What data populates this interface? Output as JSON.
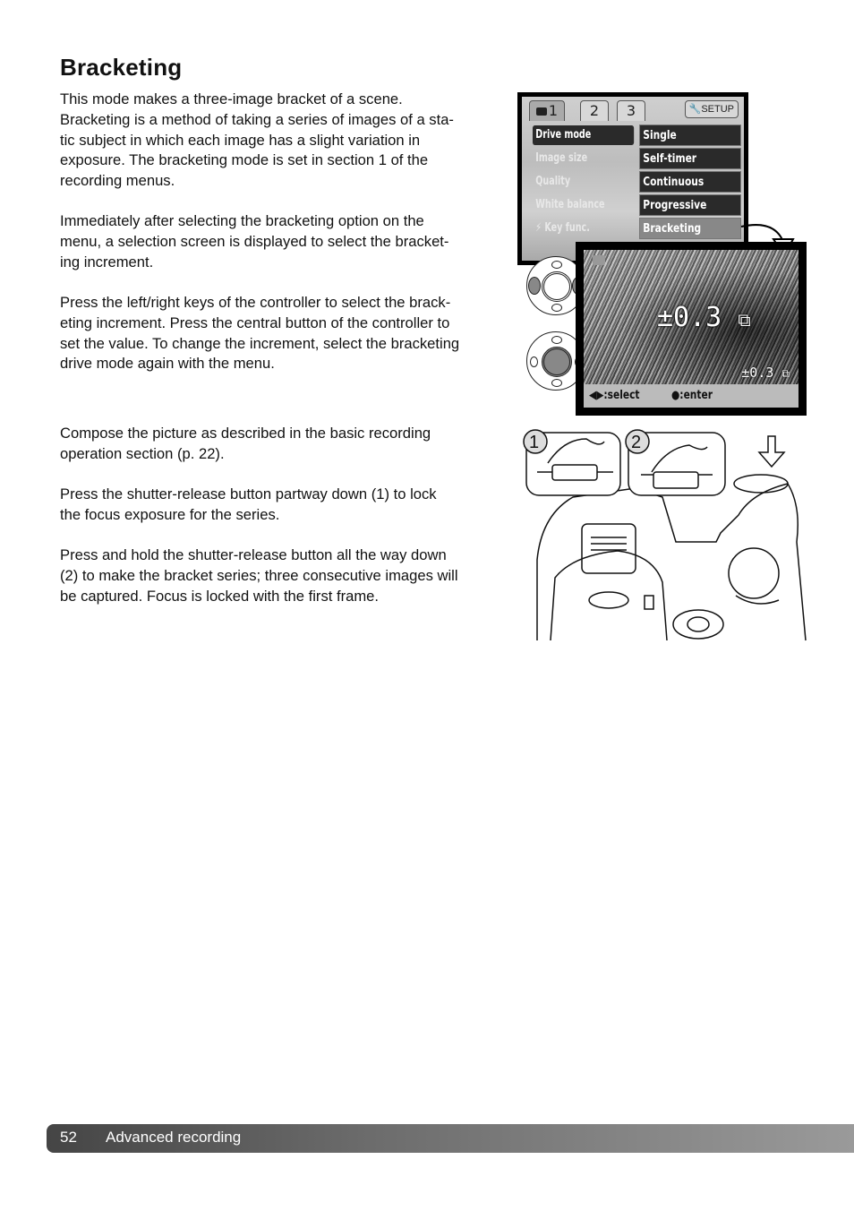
{
  "page": {
    "title": "Bracketing",
    "paragraphs": [
      [
        "This mode makes a three-image bracket of a scene.",
        "Bracketing is a method of taking a series of images of a sta-",
        "tic subject in which each image has a slight variation in",
        "exposure. The bracketing mode is set in section 1 of the",
        "recording menus."
      ],
      [
        "Immediately after selecting the bracketing option on the",
        "menu, a selection screen is displayed to select the bracket-",
        "ing increment."
      ],
      [
        "Press the left/right keys of the controller to select the brack-",
        "eting increment. Press the central button of the controller to",
        "set the value. To change the increment, select the bracketing",
        "drive mode again with the menu."
      ],
      [
        "Compose the picture as described in the basic recording",
        "operation section (p. 22)."
      ],
      [
        "Press the shutter-release button partway down (1) to lock",
        "the focus exposure for the series."
      ],
      [
        "Press and hold the shutter-release button all the way down",
        "(2) to make the bracket series; three consecutive images will",
        "be captured. Focus is locked with the first frame."
      ]
    ]
  },
  "menu_screen": {
    "tabs": [
      {
        "label": "1",
        "icon": "camera-icon",
        "active": true
      },
      {
        "label": "2",
        "active": false
      },
      {
        "label": "3",
        "active": false
      }
    ],
    "setup_label": "SETUP",
    "setup_icon": "wrench-icon",
    "items": [
      "Drive mode",
      "Image size",
      "Quality",
      "White balance",
      "Key func."
    ],
    "selected_item": "Drive mode",
    "options": [
      "Single",
      "Self-timer",
      "Continuous",
      "Progressive",
      "Bracketing"
    ],
    "highlighted_option": "Bracketing"
  },
  "preview_screen": {
    "increment_large": "±0.3",
    "increment_small": "±0.3",
    "select_hint": "◀▶:select",
    "enter_hint": "●:enter"
  },
  "shutter_steps": [
    "1",
    "2"
  ],
  "footer": {
    "page_number": "52",
    "section": "Advanced recording"
  }
}
